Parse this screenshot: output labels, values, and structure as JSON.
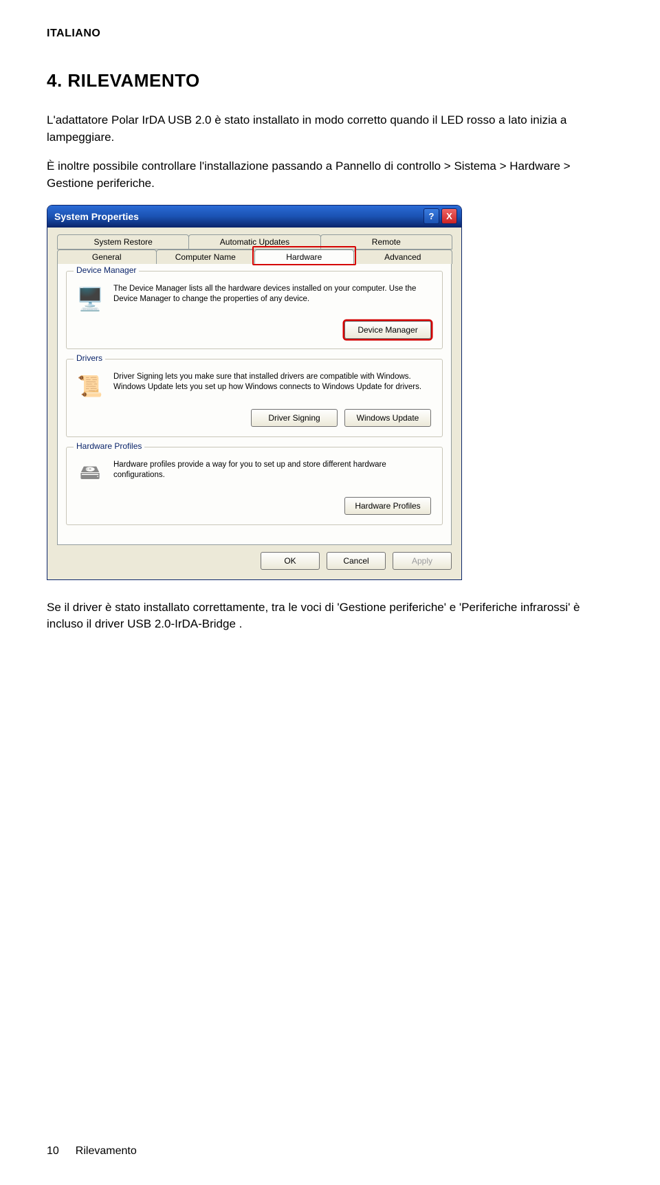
{
  "doc": {
    "lang_label": "ITALIANO",
    "heading": "4. RILEVAMENTO",
    "para1": "L'adattatore Polar IrDA USB 2.0 è stato installato in modo corretto quando il LED rosso a lato inizia a lampeggiare.",
    "para2": "È inoltre possibile controllare l'installazione passando a Pannello di controllo > Sistema > Hardware > Gestione periferiche.",
    "para3": "Se il driver è stato installato correttamente, tra le voci di 'Gestione periferiche' e 'Periferiche infrarossi' è incluso il driver USB 2.0-IrDA-Bridge .",
    "page_number": "10",
    "footer_section": "Rilevamento"
  },
  "window": {
    "title": "System Properties",
    "help_icon": "?",
    "close_icon": "X",
    "tabs_row1": [
      "System Restore",
      "Automatic Updates",
      "Remote"
    ],
    "tabs_row2": [
      "General",
      "Computer Name",
      "Hardware",
      "Advanced"
    ],
    "groups": {
      "device_manager": {
        "legend": "Device Manager",
        "desc": "The Device Manager lists all the hardware devices installed on your computer. Use the Device Manager to change the properties of any device.",
        "button": "Device Manager"
      },
      "drivers": {
        "legend": "Drivers",
        "desc": "Driver Signing lets you make sure that installed drivers are compatible with Windows. Windows Update lets you set up how Windows connects to Windows Update for drivers.",
        "btn1": "Driver Signing",
        "btn2": "Windows Update"
      },
      "hw_profiles": {
        "legend": "Hardware Profiles",
        "desc": "Hardware profiles provide a way for you to set up and store different hardware configurations.",
        "button": "Hardware Profiles"
      }
    },
    "dialog_buttons": {
      "ok": "OK",
      "cancel": "Cancel",
      "apply": "Apply"
    }
  }
}
